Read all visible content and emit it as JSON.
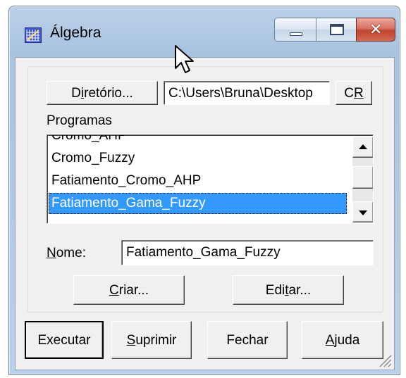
{
  "window": {
    "title": "Álgebra",
    "controls": {
      "minimize": "minimize-icon",
      "maximize": "maximize-icon",
      "close": "close-icon"
    },
    "close_glyph": "✕",
    "accent": "#3399ff"
  },
  "directory": {
    "button_prefix": "D",
    "button_underlined": "i",
    "button_suffix": "retório...",
    "path_value": "C:\\Users\\Bruna\\Desktop",
    "cr_prefix": "C",
    "cr_underlined": "R"
  },
  "programs": {
    "label": "Programas",
    "items": [
      {
        "label": "Cromo_AHP"
      },
      {
        "label": "Cromo_Fuzzy"
      },
      {
        "label": "Fatiamento_Cromo_AHP"
      },
      {
        "label": "Fatiamento_Gama_Fuzzy",
        "selected": true
      }
    ]
  },
  "name_field": {
    "label_underlined": "N",
    "label_rest": "ome:",
    "value": "Fatiamento_Gama_Fuzzy"
  },
  "actions": {
    "create_underlined": "C",
    "create_rest": "riar...",
    "edit_prefix": "Edi",
    "edit_underlined": "t",
    "edit_rest": "ar..."
  },
  "footer": {
    "execute": "Executar",
    "suppress_underlined": "S",
    "suppress_rest": "uprimir",
    "close": "Fechar",
    "help_underlined": "A",
    "help_rest": "juda"
  }
}
